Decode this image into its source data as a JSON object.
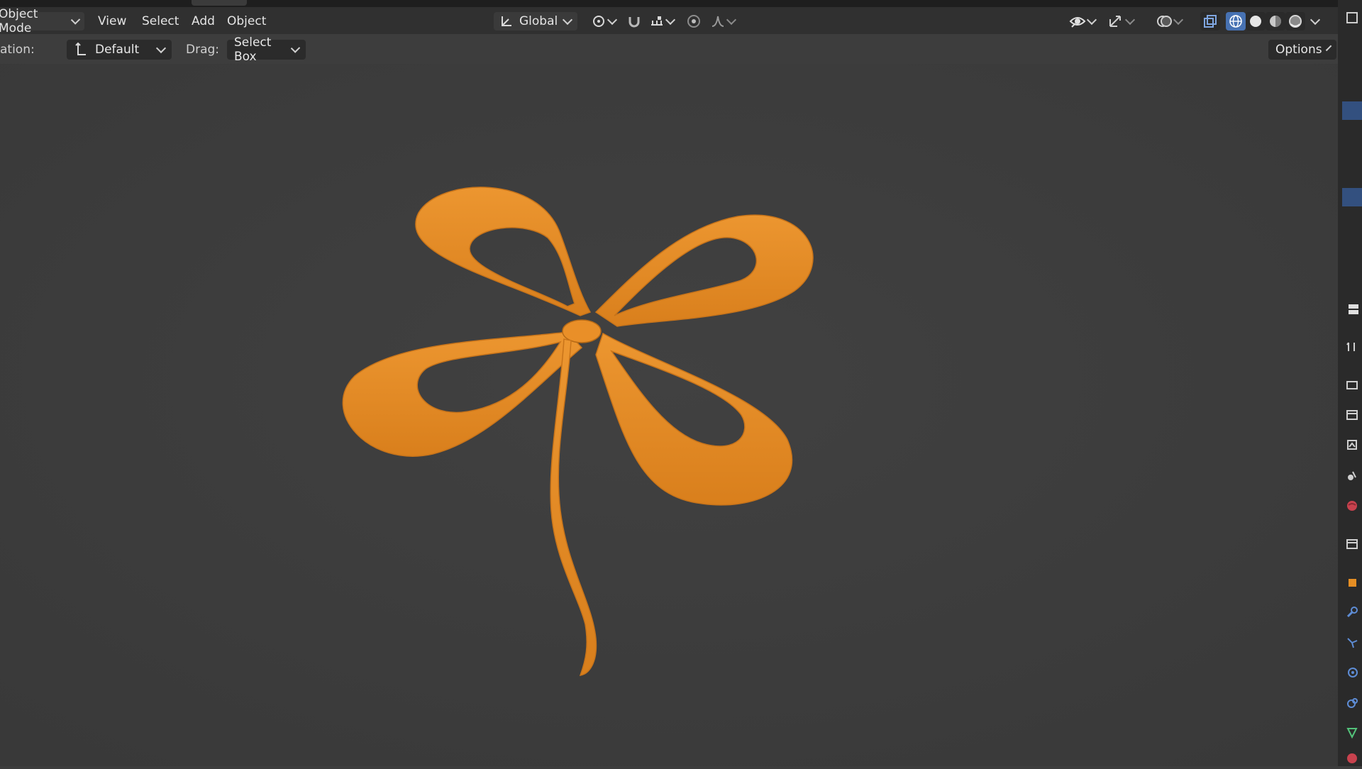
{
  "header": {
    "mode_label": "Object Mode",
    "menus": [
      "View",
      "Select",
      "Add",
      "Object"
    ],
    "transform_orientation": "Global"
  },
  "tool_settings": {
    "orientation_label": "ation:",
    "orientation_value": "Default",
    "drag_label": "Drag:",
    "drag_value": "Select Box",
    "options_label": "Options"
  },
  "colors": {
    "viewport_bg": "#3d3d3d",
    "object_orange": "#e58e24",
    "accent_blue": "#4772b3"
  },
  "icons": {
    "transform_orientation": "orientation-axes-icon",
    "pivot": "pivot-point-icon",
    "snap": "snap-magnet-icon",
    "snap_target": "snap-increment-icon",
    "proportional": "proportional-edit-icon",
    "falloff": "falloff-curve-icon",
    "visibility": "eye-icon",
    "gizmo": "gizmo-icon",
    "overlay": "overlay-icon",
    "xray": "xray-icon",
    "shading": [
      "wireframe-shading-icon",
      "solid-shading-icon",
      "material-shading-icon",
      "rendered-shading-icon"
    ]
  }
}
